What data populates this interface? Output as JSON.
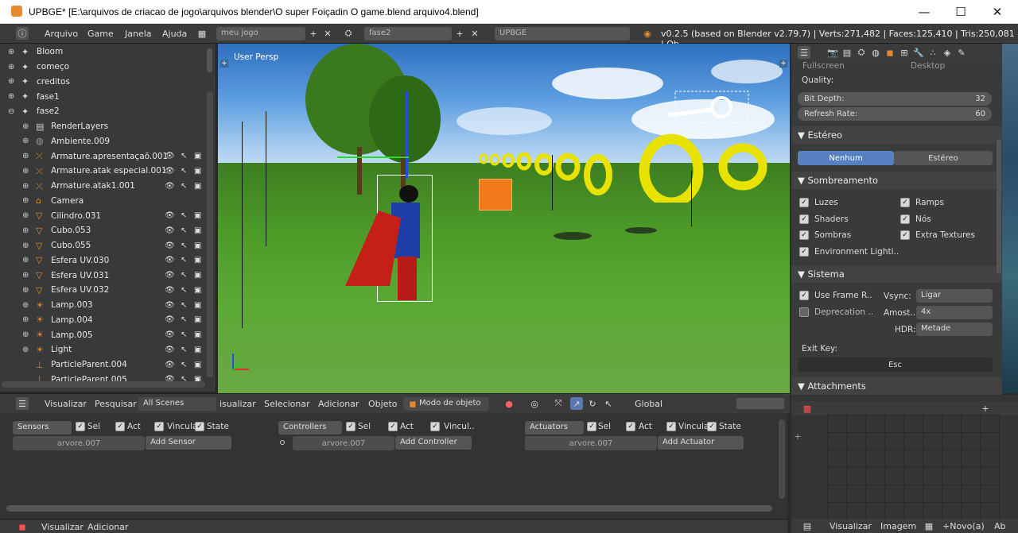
{
  "window": {
    "title": "UPBGE* [E:\\arquivos de criacao de jogo\\arquivos blender\\O super Foiçadin O game.blend arquivo4.blend]",
    "minimize": "—",
    "maximize": "☐",
    "close": "✕"
  },
  "topbar": {
    "menus": [
      "Arquivo",
      "Game",
      "Janela",
      "Ajuda"
    ],
    "screen_name": "meu jogo",
    "scene_name": "fase2",
    "engine": "UPBGE",
    "stats": "v0.2.5 (based on Blender v2.79.7) | Verts:271,482 | Faces:125,410 | Tris:250,081 | Ob"
  },
  "outliner": {
    "items": [
      {
        "label": "Bloom",
        "level": 0,
        "expand": "⊕",
        "icon": "scene-icon"
      },
      {
        "label": "começo",
        "level": 0,
        "expand": "⊕",
        "icon": "scene-icon"
      },
      {
        "label": "creditos",
        "level": 0,
        "expand": "⊕",
        "icon": "scene-icon"
      },
      {
        "label": "fase1",
        "level": 0,
        "expand": "⊕",
        "icon": "scene-icon"
      },
      {
        "label": "fase2",
        "level": 0,
        "expand": "⊖",
        "icon": "scene-icon"
      },
      {
        "label": "RenderLayers",
        "level": 1,
        "expand": "⊕",
        "icon": "renderlayers-icon"
      },
      {
        "label": "Ambiente.009",
        "level": 1,
        "expand": "⊕",
        "icon": "world-icon"
      },
      {
        "label": "Armature.apresentaçaõ.001",
        "level": 1,
        "expand": "⊕",
        "icon": "armature-icon"
      },
      {
        "label": "Armature.atak especial.001",
        "level": 1,
        "expand": "⊕",
        "icon": "armature-icon"
      },
      {
        "label": "Armature.atak1.001",
        "level": 1,
        "expand": "⊕",
        "icon": "armature-icon"
      },
      {
        "label": "Camera",
        "level": 1,
        "expand": "⊕",
        "icon": "camera-icon"
      },
      {
        "label": "Cilindro.031",
        "level": 1,
        "expand": "⊕",
        "icon": "mesh-icon"
      },
      {
        "label": "Cubo.053",
        "level": 1,
        "expand": "⊕",
        "icon": "mesh-icon"
      },
      {
        "label": "Cubo.055",
        "level": 1,
        "expand": "⊕",
        "icon": "mesh-icon"
      },
      {
        "label": "Esfera UV.030",
        "level": 1,
        "expand": "⊕",
        "icon": "mesh-icon"
      },
      {
        "label": "Esfera UV.031",
        "level": 1,
        "expand": "⊕",
        "icon": "mesh-icon"
      },
      {
        "label": "Esfera UV.032",
        "level": 1,
        "expand": "⊕",
        "icon": "mesh-icon"
      },
      {
        "label": "Lamp.003",
        "level": 1,
        "expand": "⊕",
        "icon": "lamp-icon"
      },
      {
        "label": "Lamp.004",
        "level": 1,
        "expand": "⊕",
        "icon": "lamp-icon"
      },
      {
        "label": "Lamp.005",
        "level": 1,
        "expand": "⊕",
        "icon": "lamp-icon"
      },
      {
        "label": "Light",
        "level": 1,
        "expand": "⊕",
        "icon": "lamp-icon"
      },
      {
        "label": "ParticleParent.004",
        "level": 1,
        "expand": "",
        "icon": "empty-icon"
      },
      {
        "label": "ParticleParent.005",
        "level": 1,
        "expand": "",
        "icon": "empty-icon"
      }
    ],
    "header": {
      "menu1": "Visualizar",
      "menu2": "Pesquisar",
      "filter": "All Scenes"
    }
  },
  "viewport": {
    "label": "User Persp",
    "header": {
      "menus": [
        "isualizar",
        "Selecionar",
        "Adicionar",
        "Objeto"
      ],
      "mode": "Modo de objeto",
      "orientation": "Global"
    }
  },
  "properties": {
    "partial_top": "Fullscreen",
    "partial_top2": "Desktop",
    "quality_label": "Quality:",
    "bit_depth_label": "Bit Depth:",
    "bit_depth_value": "32",
    "refresh_label": "Refresh Rate:",
    "refresh_value": "60",
    "stereo_panel": "Estéreo",
    "stereo_none": "Nenhum",
    "stereo_stereo": "Estéreo",
    "shading_panel": "Sombreamento",
    "shading": [
      {
        "label": "Luzes",
        "checked": true
      },
      {
        "label": "Ramps",
        "checked": true
      },
      {
        "label": "Shaders",
        "checked": true
      },
      {
        "label": "Nós",
        "checked": true
      },
      {
        "label": "Sombras",
        "checked": true
      },
      {
        "label": "Extra Textures",
        "checked": true
      },
      {
        "label": "Environment Lighti..",
        "checked": true
      }
    ],
    "system_panel": "Sistema",
    "use_frame_rate": "Use Frame R..",
    "deprecation": "Deprecation ..",
    "vsync_label": "Vsync:",
    "vsync_value": "Ligar",
    "samples_label": "Amost..",
    "samples_value": "4x",
    "hdr_label": "HDR:",
    "hdr_value": "Metade",
    "exit_key_label": "Exit Key:",
    "exit_key_value": "Esc",
    "attachments_panel": "Attachments"
  },
  "logic": {
    "sensors": {
      "title": "Sensors",
      "object": "arvore.007",
      "add": "Add Sensor"
    },
    "controllers": {
      "title": "Controllers",
      "object": "arvore.007",
      "add": "Add Controller"
    },
    "actuators": {
      "title": "Actuators",
      "object": "arvore.007",
      "add": "Add Actuator"
    },
    "toggles": {
      "sel": "Sel",
      "act": "Act",
      "vincula": "Vincula",
      "state": "State",
      "vincul_short": "Vincul.."
    },
    "header": {
      "menu1": "Visualizar",
      "menu2": "Adicionar"
    }
  },
  "image_editor_header": {
    "menu1": "Visualizar",
    "menu2": "Imagem",
    "new_btn": "+Novo(a)",
    "extra": "Ab"
  }
}
